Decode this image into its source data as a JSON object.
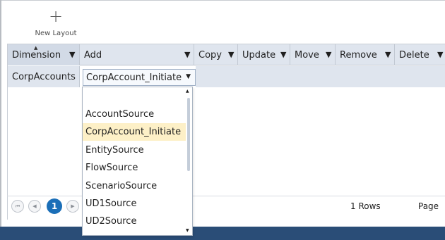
{
  "toolbar": {
    "new_layout_label": "New Layout",
    "new_layout_icon": "plus-icon"
  },
  "grid": {
    "columns": [
      {
        "label": "Dimension"
      },
      {
        "label": "Add"
      },
      {
        "label": "Copy"
      },
      {
        "label": "Update"
      },
      {
        "label": "Move"
      },
      {
        "label": "Remove"
      },
      {
        "label": "Delete"
      }
    ],
    "rows": [
      {
        "dimension": "CorpAccounts",
        "add": "CorpAccount_Initiate"
      }
    ]
  },
  "dropdown": {
    "options": [
      "AccountSource",
      "CorpAccount_Initiate",
      "EntitySource",
      "FlowSource",
      "ScenarioSource",
      "UD1Source",
      "UD2Source"
    ],
    "selected": "CorpAccount_Initiate"
  },
  "pager": {
    "current_page": "1",
    "rows_text": "1 Rows",
    "page_label": "Page"
  },
  "colors": {
    "header_bg": "#dfe5ee",
    "selected_item": "#fdf0c7",
    "page_accent": "#1b6fb8",
    "footer_bar": "#2a4d77"
  }
}
